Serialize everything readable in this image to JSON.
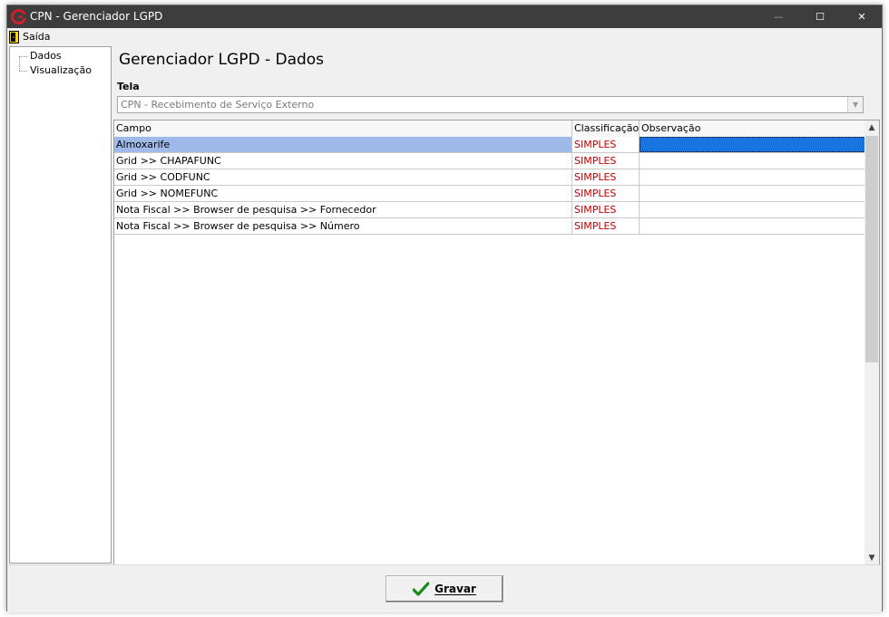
{
  "window": {
    "title": "CPN - Gerenciador LGPD",
    "controls": {
      "minimize": "—",
      "maximize": "☐",
      "close": "✕"
    }
  },
  "menu": {
    "exit_label": "Saída"
  },
  "sidebar": {
    "items": [
      {
        "label": "Dados"
      },
      {
        "label": "Visualização"
      }
    ]
  },
  "main": {
    "title": "Gerenciador LGPD - Dados",
    "tela_label": "Tela",
    "tela_value": "CPN - Recebimento de Serviço Externo",
    "grid": {
      "columns": [
        "Campo",
        "Classificação",
        "Observação"
      ],
      "rows": [
        {
          "campo": "Almoxarife",
          "classificacao": "SIMPLES",
          "observacao": ""
        },
        {
          "campo": "Grid >> CHAPAFUNC",
          "classificacao": "SIMPLES",
          "observacao": ""
        },
        {
          "campo": "Grid >> CODFUNC",
          "classificacao": "SIMPLES",
          "observacao": ""
        },
        {
          "campo": "Grid >> NOMEFUNC",
          "classificacao": "SIMPLES",
          "observacao": ""
        },
        {
          "campo": "Nota Fiscal >> Browser de pesquisa >> Fornecedor",
          "classificacao": "SIMPLES",
          "observacao": ""
        },
        {
          "campo": "Nota Fiscal >> Browser de pesquisa >> Número",
          "classificacao": "SIMPLES",
          "observacao": ""
        }
      ],
      "selected_row": 0
    }
  },
  "footer": {
    "save_label": "Gravar"
  },
  "colors": {
    "titlebar": "#3d3d3d",
    "selected_row": "#9fb9e8",
    "selected_cell": "#1874e0",
    "classification_text": "#c00000",
    "check_icon": "#1a8a1a"
  },
  "icons": {
    "app": "cpn-logo-icon",
    "exit": "door-exit-icon",
    "save": "checkmark-icon"
  }
}
